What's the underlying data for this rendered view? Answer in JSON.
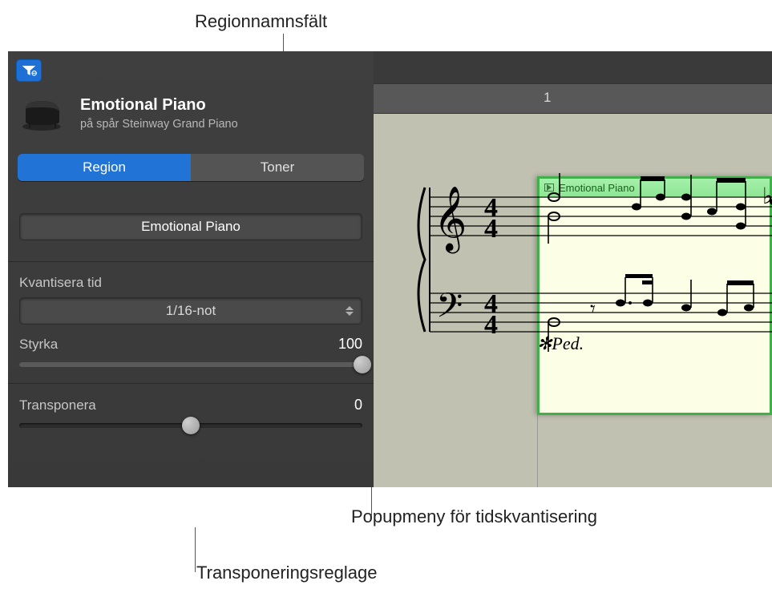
{
  "annotations": {
    "region_name_field": "Regionnamnsfält",
    "time_quantize_popup": "Popupmeny för tidskvantisering",
    "transpose_slider": "Transponeringsreglage"
  },
  "inspector": {
    "region_title": "Emotional Piano",
    "track_subtitle": "på spår Steinway Grand Piano",
    "tabs": {
      "region": "Region",
      "notes": "Toner"
    },
    "region_name": "Emotional Piano",
    "quantize": {
      "label": "Kvantisera tid",
      "value": "1/16-not"
    },
    "strength": {
      "label": "Styrka",
      "value": "100",
      "percent": 100
    },
    "transpose": {
      "label": "Transponera",
      "value": "0",
      "percent": 50
    }
  },
  "timeline": {
    "bar_number": "1",
    "region_name": "Emotional Piano",
    "pedal_mark": "✻Ped."
  },
  "icons": {
    "filter": "filter-icon",
    "piano": "piano-icon",
    "chevron": "chevron-updown-icon",
    "play": "play-icon"
  }
}
